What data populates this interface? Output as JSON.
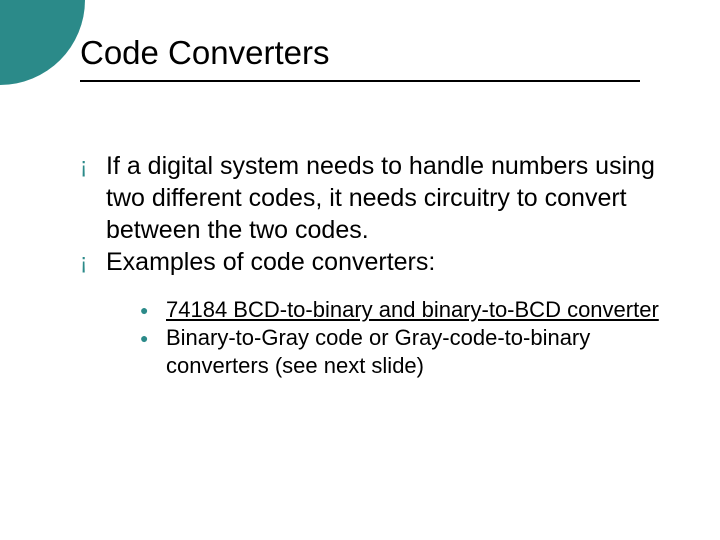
{
  "title": "Code Converters",
  "bullets": {
    "level1": [
      "If a digital system needs to handle numbers using two different codes, it needs circuitry to convert between the two codes.",
      "Examples of code converters:"
    ],
    "level2": [
      {
        "linked_text": "74184 BCD-to-binary and binary-to-BCD converter",
        "trailing_text": ""
      },
      {
        "linked_text": "",
        "trailing_text": "Binary-to-Gray code or Gray-code-to-binary converters (see next slide)"
      }
    ]
  },
  "glyphs": {
    "open_circle": "¡",
    "filled_dot": "●"
  }
}
